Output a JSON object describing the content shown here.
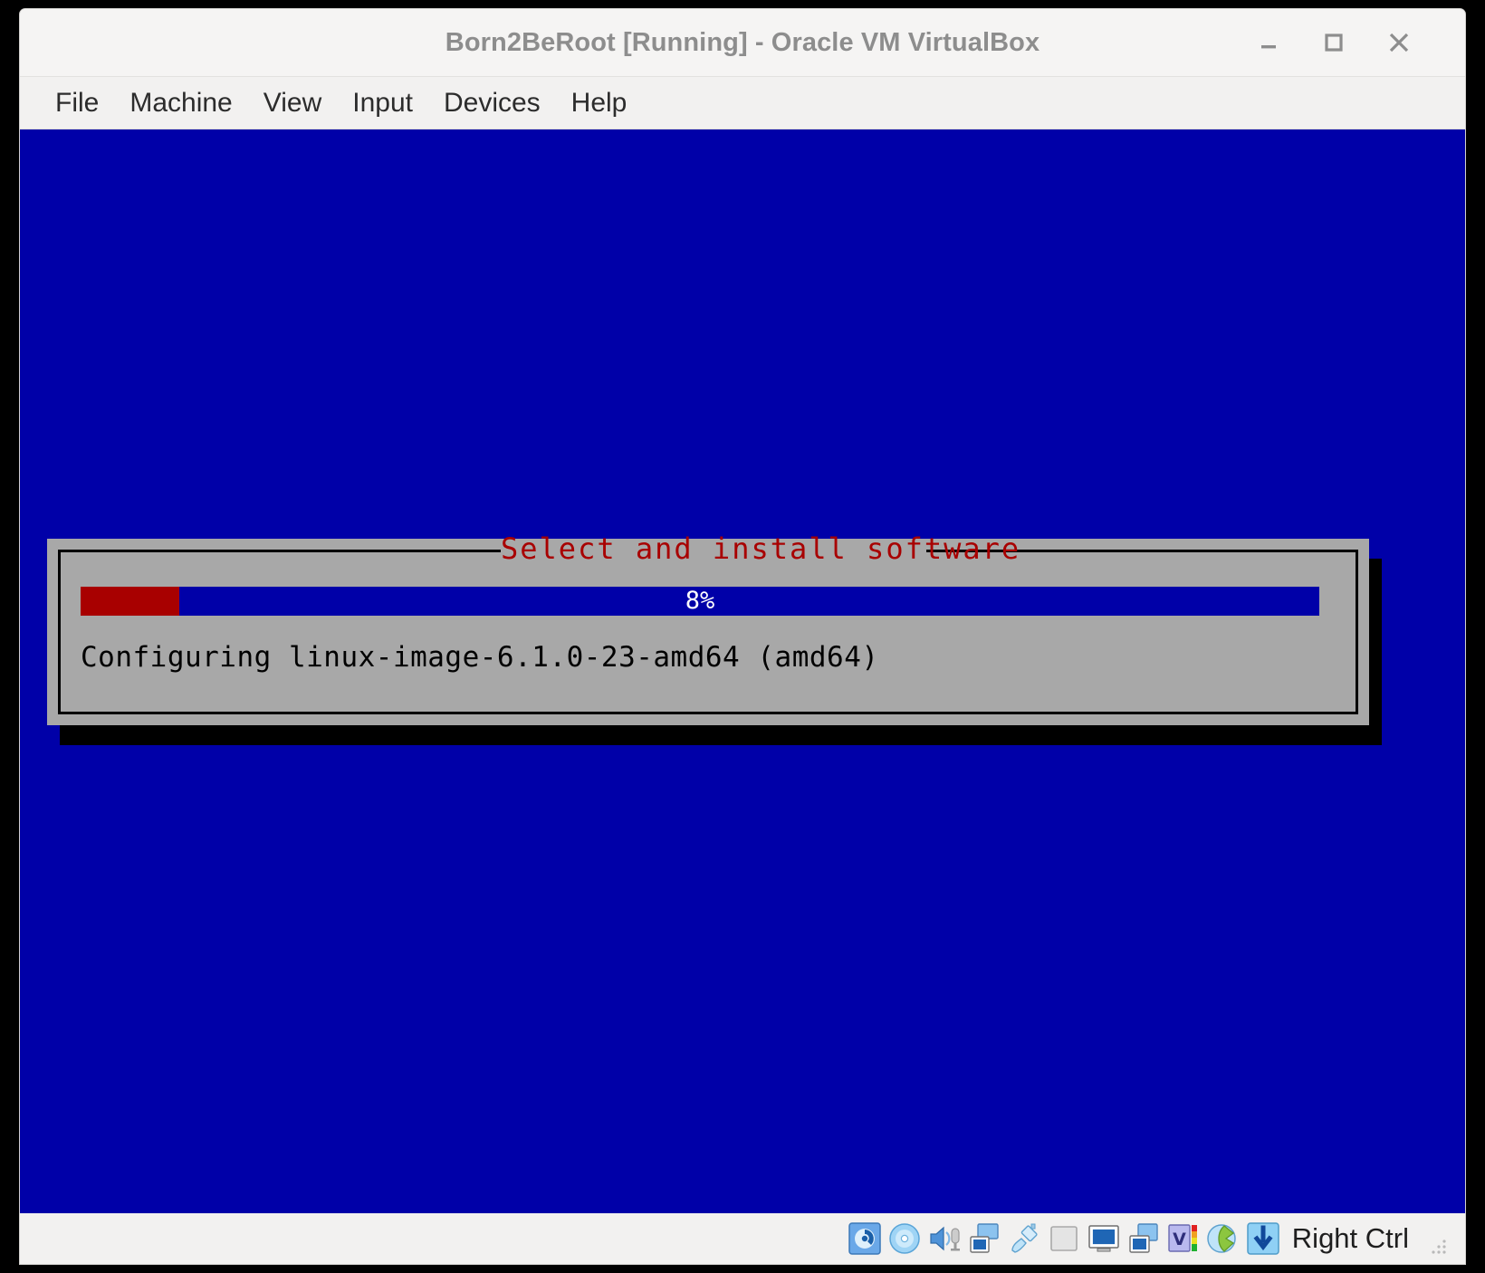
{
  "window": {
    "title": "Born2BeRoot [Running] - Oracle VM VirtualBox",
    "controls": {
      "minimize_name": "minimize-button",
      "maximize_name": "maximize-button",
      "close_name": "close-button"
    }
  },
  "menubar": {
    "items": [
      {
        "label": "File"
      },
      {
        "label": "Machine"
      },
      {
        "label": "View"
      },
      {
        "label": "Input"
      },
      {
        "label": "Devices"
      },
      {
        "label": "Help"
      }
    ]
  },
  "vm_screen": {
    "background_color": "#0000a8",
    "dialog": {
      "title": "Select and install software",
      "title_color": "#a80000",
      "panel_color": "#a8a8a8",
      "progress": {
        "percent_label": "8%",
        "percent_value": 8,
        "fill_color": "#a80000",
        "track_color": "#0000a8"
      },
      "status_text": "Configuring linux-image-6.1.0-23-amd64 (amd64)"
    }
  },
  "statusbar": {
    "icons": [
      {
        "name": "hard-disk-icon"
      },
      {
        "name": "optical-disk-icon"
      },
      {
        "name": "audio-icon"
      },
      {
        "name": "network-icon"
      },
      {
        "name": "usb-icon"
      },
      {
        "name": "shared-folders-icon"
      },
      {
        "name": "display-icon"
      },
      {
        "name": "recording-icon"
      },
      {
        "name": "features-icon"
      },
      {
        "name": "mouse-integration-icon"
      },
      {
        "name": "host-key-icon"
      }
    ],
    "host_key_label": "Right Ctrl"
  }
}
